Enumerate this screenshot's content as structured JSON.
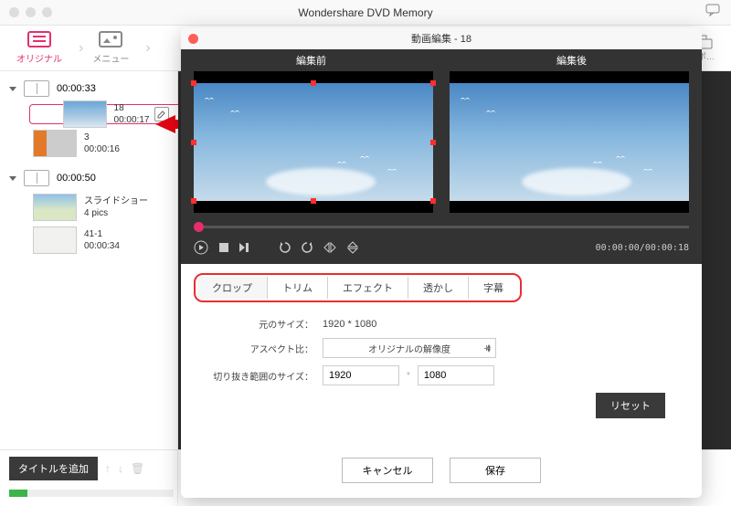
{
  "app": {
    "title": "Wondershare DVD Memory"
  },
  "toolbar": {
    "original_label": "オリジナル",
    "menu_label": "メニュー",
    "burn_label": "ルポ…"
  },
  "sidebar": {
    "titles": [
      {
        "duration": "00:00:33",
        "clips": [
          {
            "name": "18",
            "duration": "00:00:17",
            "selected": true
          },
          {
            "name": "3",
            "duration": "00:00:16"
          }
        ]
      },
      {
        "duration": "00:00:50",
        "clips": [
          {
            "name": "スライドショー",
            "duration": "4 pics"
          },
          {
            "name": "41-1",
            "duration": "00:00:34"
          }
        ]
      }
    ],
    "add_title_label": "タイトルを追加"
  },
  "modal": {
    "title": "動画編集 - 18",
    "before_label": "編集前",
    "after_label": "編集後",
    "timecode": "00:00:00/00:00:18",
    "tabs": [
      "クロップ",
      "トリム",
      "エフェクト",
      "透かし",
      "字幕"
    ],
    "crop": {
      "orig_size_label": "元のサイズ：",
      "orig_size_value": "1920 * 1080",
      "aspect_label": "アスペクト比：",
      "aspect_value": "オリジナルの解像度",
      "crop_size_label": "切り抜き範囲のサイズ：",
      "crop_w": "1920",
      "crop_h": "1080",
      "reset_label": "リセット"
    },
    "cancel_label": "キャンセル",
    "save_label": "保存"
  }
}
